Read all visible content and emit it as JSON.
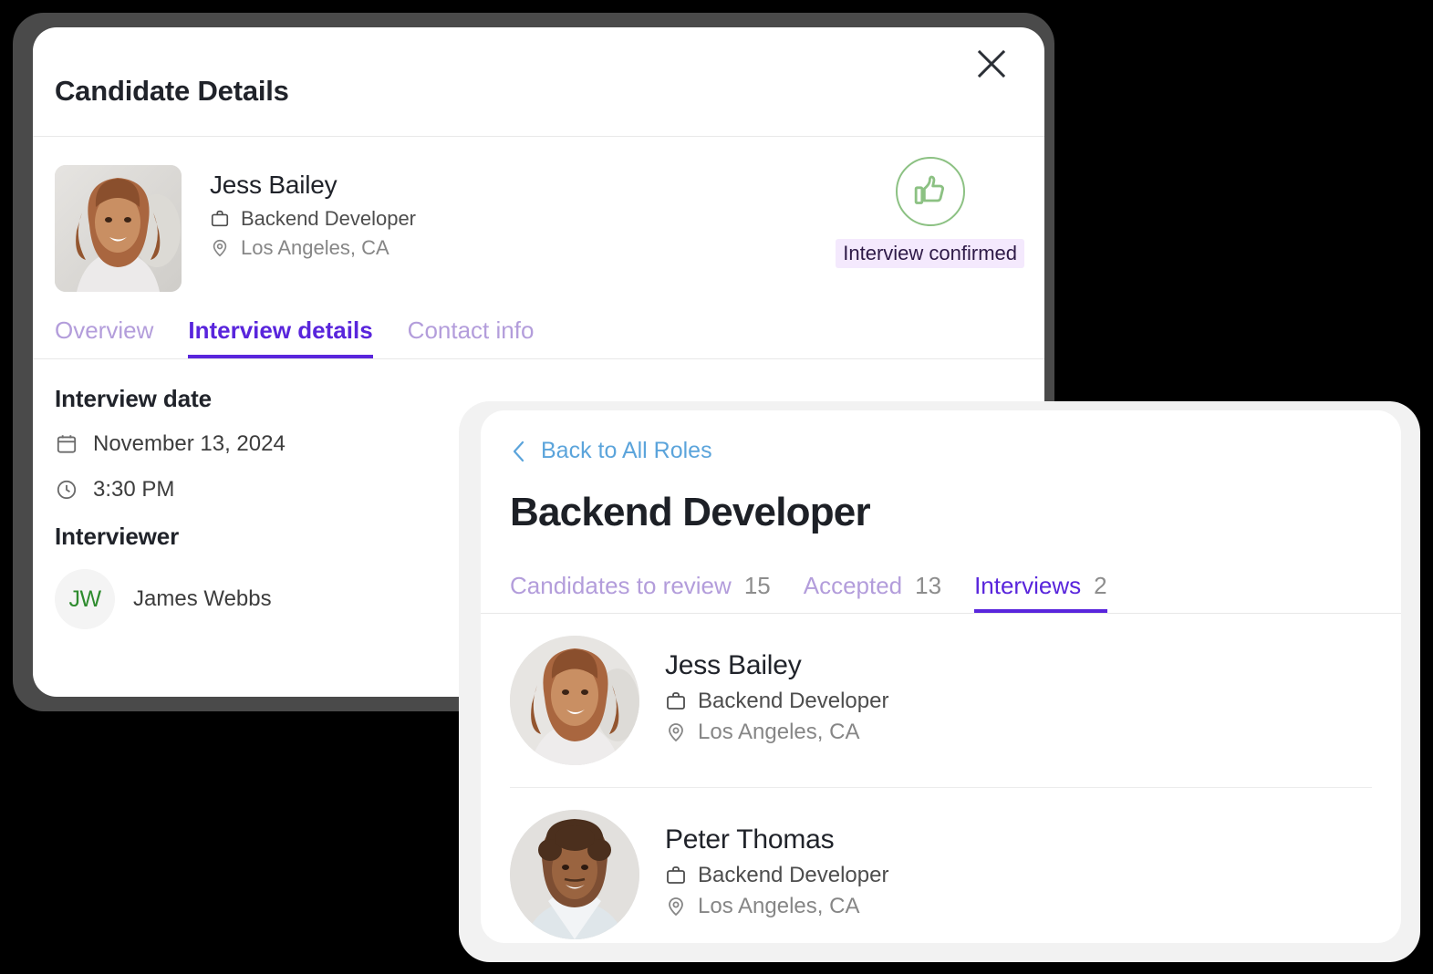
{
  "colors": {
    "accent_purple": "#5925DC",
    "tab_inactive_purple": "#B39DDB",
    "link_blue": "#5BA4DB",
    "badge_bg": "#F4E9FD",
    "badge_text": "#2E1A47",
    "green": "#2E8B2E",
    "thumb_green": "#8CC183",
    "frame_dark": "#4A4A4A",
    "background": "#000000"
  },
  "candidate_details_card": {
    "title": "Candidate Details",
    "close_icon": "close-icon",
    "person": {
      "name": "Jess Bailey",
      "role": "Backend Developer",
      "role_icon": "briefcase-icon",
      "location": "Los Angeles, CA",
      "location_icon": "location-pin-icon",
      "avatar_alt": "Jess Bailey photo"
    },
    "status": {
      "icon": "thumbs-up-icon",
      "label": "Interview confirmed"
    },
    "tabs": [
      {
        "label": "Overview",
        "active": false
      },
      {
        "label": "Interview details",
        "active": true
      },
      {
        "label": "Contact info",
        "active": false
      }
    ],
    "interview": {
      "date_section_title": "Interview date",
      "date": "November 13, 2024",
      "date_icon": "calendar-icon",
      "time": "3:30 PM",
      "time_icon": "clock-icon",
      "interviewer_section_title": "Interviewer",
      "interviewer_initials": "JW",
      "interviewer_name": "James Webbs"
    }
  },
  "role_card": {
    "back_link": "Back to All Roles",
    "back_icon": "chevron-left-icon",
    "title": "Backend Developer",
    "tabs": [
      {
        "label": "Candidates to review",
        "count": "15",
        "active": false
      },
      {
        "label": "Accepted",
        "count": "13",
        "active": false
      },
      {
        "label": "Interviews",
        "count": "2",
        "active": true
      }
    ],
    "candidates": [
      {
        "name": "Jess Bailey",
        "role": "Backend Developer",
        "role_icon": "briefcase-icon",
        "location": "Los Angeles, CA",
        "location_icon": "location-pin-icon",
        "avatar_alt": "Jess Bailey photo"
      },
      {
        "name": "Peter Thomas",
        "role": "Backend Developer",
        "role_icon": "briefcase-icon",
        "location": "Los Angeles, CA",
        "location_icon": "location-pin-icon",
        "avatar_alt": "Peter Thomas photo"
      }
    ]
  }
}
